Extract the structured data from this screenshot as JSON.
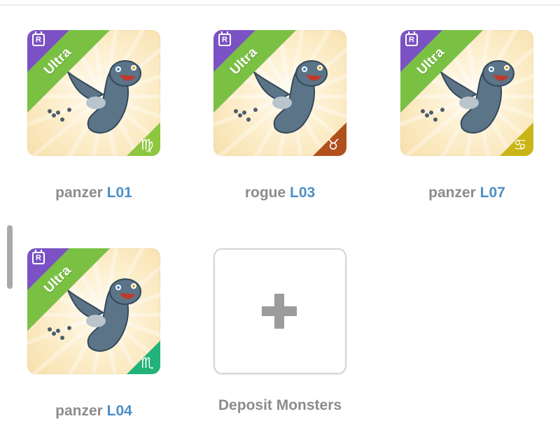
{
  "monsters": [
    {
      "name": "panzer",
      "level": "L01",
      "rarity_label": "Ultra",
      "calendar_letter": "R",
      "zodiac_symbol": "♍",
      "zodiac_name": "virgo",
      "corner_color": "#8dc63f"
    },
    {
      "name": "rogue",
      "level": "L03",
      "rarity_label": "Ultra",
      "calendar_letter": "R",
      "zodiac_symbol": "♉",
      "zodiac_name": "taurus",
      "corner_color": "#b0501c"
    },
    {
      "name": "panzer",
      "level": "L07",
      "rarity_label": "Ultra",
      "calendar_letter": "R",
      "zodiac_symbol": "♋",
      "zodiac_name": "cancer",
      "corner_color": "#c9b516"
    },
    {
      "name": "panzer",
      "level": "L04",
      "rarity_label": "Ultra",
      "calendar_letter": "R",
      "zodiac_symbol": "♏",
      "zodiac_name": "scorpio",
      "corner_color": "#22b27a"
    }
  ],
  "deposit": {
    "label": "Deposit Monsters",
    "icon": "plus-icon"
  },
  "colors": {
    "ribbon_green": "#7ac143",
    "badge_purple": "#7b52c4",
    "level_blue": "#4a8fc8",
    "name_gray": "#8c8c8c"
  }
}
